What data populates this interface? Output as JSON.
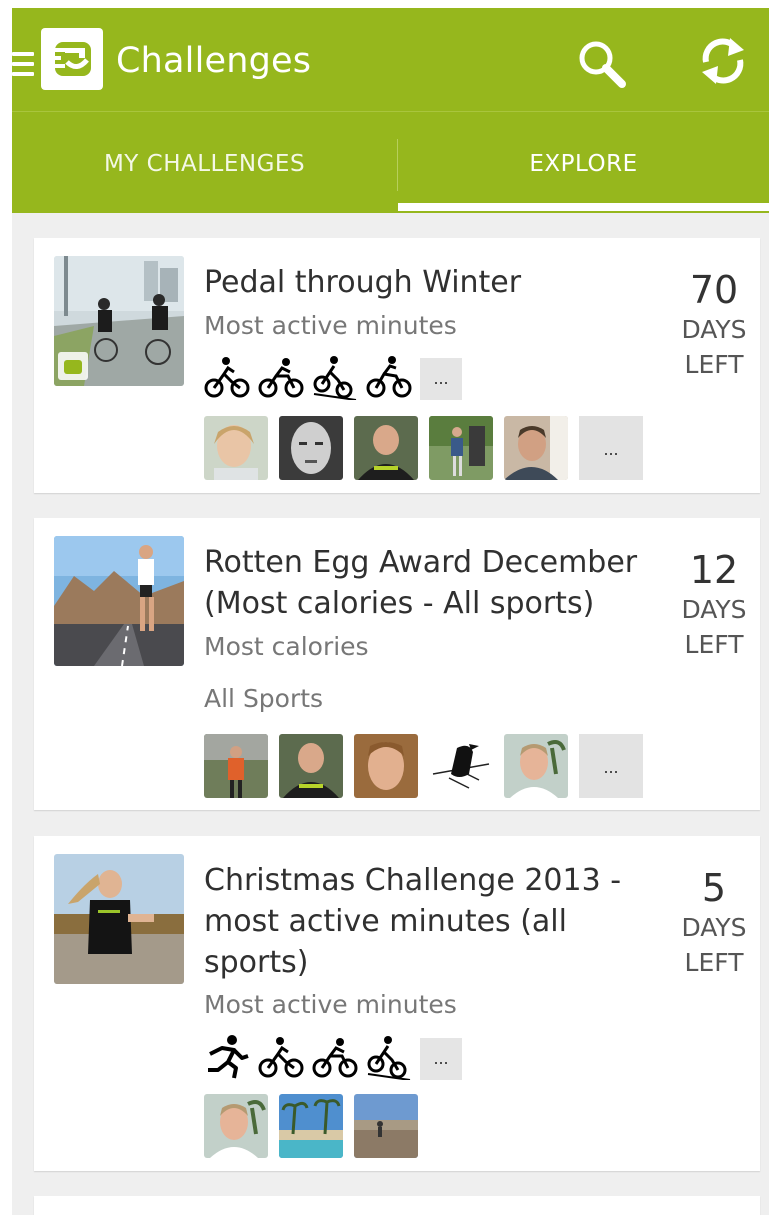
{
  "appbar": {
    "title": "Challenges",
    "brand_color": "#96b71d",
    "icons": [
      "menu-icon",
      "app-logo",
      "search-icon",
      "refresh-icon"
    ]
  },
  "tabs": [
    {
      "label": "MY CHALLENGES",
      "selected": false
    },
    {
      "label": "EXPLORE",
      "selected": true
    }
  ],
  "challenges": [
    {
      "title": "Pedal through Winter",
      "metric": "Most active minutes",
      "sports": [
        "cycling-icon",
        "cycling-icon",
        "mountain-biking-icon",
        "cycling-icon"
      ],
      "sports_more": "...",
      "avatars": [
        "avatar-woman",
        "avatar-man",
        "avatar-man",
        "avatar-runner",
        "avatar-man"
      ],
      "avatars_more": "...",
      "days": "70",
      "days_label_1": "DAYS",
      "days_label_2": "LEFT"
    },
    {
      "title_line1": "Rotten Egg Award December",
      "title_line2": "(Most calories - All sports)",
      "metric": "Most calories",
      "sports_text": "All Sports",
      "avatars": [
        "avatar-runner",
        "avatar-man",
        "avatar-man",
        "avatar-bird",
        "avatar-man"
      ],
      "avatars_more": "...",
      "days": "12",
      "days_label_1": "DAYS",
      "days_label_2": "LEFT"
    },
    {
      "title_line1": "Christmas Challenge 2013 -",
      "title_line2": "most active minutes (all",
      "title_line3": "sports)",
      "metric": "Most active minutes",
      "sports": [
        "running-icon",
        "cycling-icon",
        "cycling-icon",
        "mountain-biking-icon"
      ],
      "sports_more": "...",
      "avatars": [
        "avatar-man",
        "avatar-palms",
        "avatar-landscape"
      ],
      "days": "5",
      "days_label_1": "DAYS",
      "days_label_2": "LEFT"
    }
  ]
}
